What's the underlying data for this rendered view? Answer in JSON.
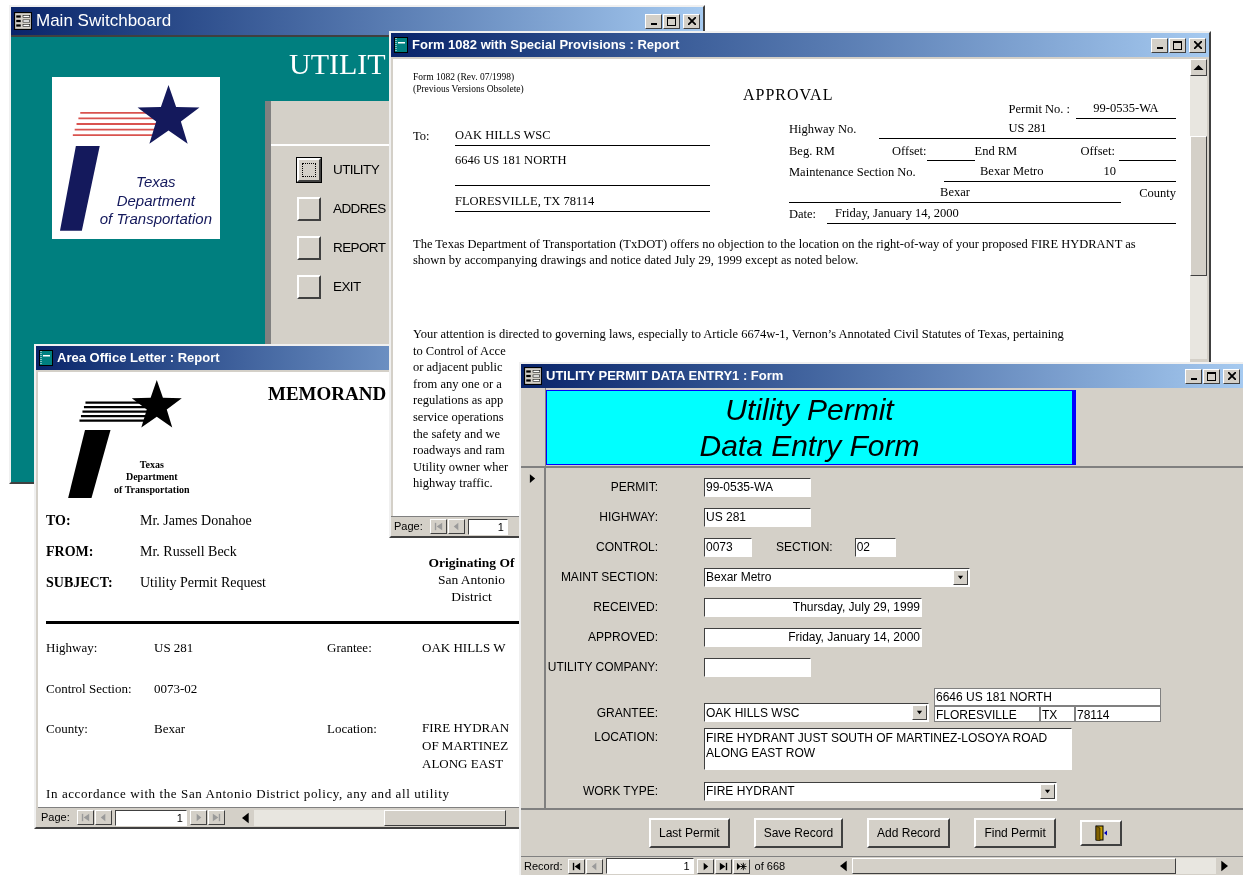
{
  "switchboard": {
    "title": "Main Switchboard",
    "heading": "UTILIT",
    "logo_lines": [
      "Texas",
      "Department",
      "of Transportation"
    ],
    "items": [
      {
        "label": "UTILITY",
        "focused": true
      },
      {
        "label": "ADDRES",
        "focused": false
      },
      {
        "label": "REPORT",
        "focused": false
      },
      {
        "label": "EXIT",
        "focused": false
      }
    ]
  },
  "approval_report": {
    "title": "Form 1082 with Special Provisions : Report",
    "form_note": [
      "Form 1082 (Rev. 07/1998)",
      "(Previous Versions Obsolete)"
    ],
    "heading": "APPROVAL",
    "permit_label": "Permit No. :",
    "permit": "99-0535-WA",
    "to_label": "To:",
    "address": {
      "name": "OAK HILLS WSC",
      "street": "6646 US 181 NORTH",
      "city": "FLORESVILLE,  TX  78114"
    },
    "highway_label": "Highway No.",
    "highway": "US 281",
    "beg_rm_label": "Beg. RM",
    "offset_label_1": "Offset:",
    "end_rm_label": "End RM",
    "offset_label_2": "Offset:",
    "maint_label": "Maintenance Section No.",
    "maint_section": "Bexar Metro",
    "maint_number": "10",
    "county": "Bexar",
    "county_label": "County",
    "date_label": "Date:",
    "date": "Friday, January 14, 2000",
    "paragraph_1": "The Texas Department of Transportation (TxDOT) offers no objection to the location on the right-of-way of your proposed FIRE HYDRANT as shown by accompanying drawings and notice dated July 29, 1999 except as noted below.",
    "paragraph_2_lines": [
      "Your attention is directed to governing laws, especially to Article 6674w-1, Vernon’s Annotated Civil Statutes of Texas, pertaining",
      "to Control of Acce",
      "or adjacent public",
      "from any one or a",
      "regulations as app",
      "service operations",
      "the safety and we",
      "roadways and ram",
      "Utility owner wher",
      "highway traffic."
    ],
    "page_label": "Page:",
    "page": "1"
  },
  "letter": {
    "title": "Area Office Letter : Report",
    "heading": "MEMORAND",
    "logo_lines": [
      "Texas",
      "Department",
      "of Transportation"
    ],
    "header_rows": [
      {
        "label": "TO:",
        "value": "Mr. James Donahoe"
      },
      {
        "label": "FROM:",
        "value": "Mr. Russell Beck"
      },
      {
        "label": "SUBJECT:",
        "value": "Utility Permit Request"
      }
    ],
    "originating": [
      "Originating Of",
      "San Antonio",
      "District"
    ],
    "highway_label": "Highway:",
    "highway": "US 281",
    "grantee_label": "Grantee:",
    "grantee": "OAK HILLS W",
    "control_label": "Control Section:",
    "control": "0073-02",
    "county_label": "County:",
    "county": "Bexar",
    "location_label": "Location:",
    "location_lines": [
      "FIRE HYDRAN",
      "OF MARTINEZ",
      "ALONG EAST"
    ],
    "paragraph": "In accordance with the San Antonio District policy, any and all utility",
    "page_label": "Page:",
    "page": "1"
  },
  "data_entry": {
    "title": "UTILITY PERMIT DATA ENTRY1 : Form",
    "banner": [
      "Utility Permit",
      "Data Entry Form"
    ],
    "rows": [
      {
        "fields": [
          {
            "label": "PERMIT:",
            "value": "99-0535-WA",
            "kind": "text"
          }
        ]
      },
      {
        "fields": [
          {
            "label": "HIGHWAY:",
            "value": "US 281",
            "kind": "text"
          }
        ]
      },
      {
        "fields": [
          {
            "label": "CONTROL:",
            "value": "0073",
            "kind": "short"
          },
          {
            "label": "SECTION:",
            "value": "02",
            "kind": "tiny"
          }
        ]
      },
      {
        "fields": [
          {
            "label": "MAINT SECTION:",
            "value": "Bexar Metro",
            "kind": "combo"
          }
        ]
      },
      {
        "fields": [
          {
            "label": "RECEIVED:",
            "value": "Thursday, July 29, 1999",
            "kind": "date"
          }
        ]
      },
      {
        "fields": [
          {
            "label": "APPROVED:",
            "value": "Friday, January 14, 2000",
            "kind": "date"
          }
        ]
      },
      {
        "fields": [
          {
            "label": "UTILITY COMPANY:",
            "kind": "text"
          }
        ]
      },
      {
        "fields": [
          {
            "label": "GRANTEE:",
            "value": "OAK HILLS WSC",
            "kind": "grantee"
          }
        ],
        "address": {
          "street": "6646 US 181 NORTH",
          "city": "FLORESVILLE",
          "state": "TX",
          "zip": "78114"
        }
      },
      {
        "fields": [
          {
            "label": "LOCATION:",
            "value": "FIRE HYDRANT JUST SOUTH OF MARTINEZ-LOSOYA ROAD ALONG EAST ROW",
            "kind": "memo"
          }
        ]
      },
      {
        "fields": [
          {
            "label": "WORK TYPE:",
            "value": "FIRE HYDRANT",
            "kind": "combo_wide"
          }
        ]
      }
    ],
    "buttons": [
      {
        "kind": "text",
        "label": "Last Permit"
      },
      {
        "kind": "text",
        "label": "Save Record"
      },
      {
        "kind": "text",
        "label": "Add Record"
      },
      {
        "kind": "text",
        "label": "Find Permit"
      },
      {
        "kind": "exit"
      }
    ],
    "record_label": "Record:",
    "record": "1",
    "record_count": "of 668"
  }
}
